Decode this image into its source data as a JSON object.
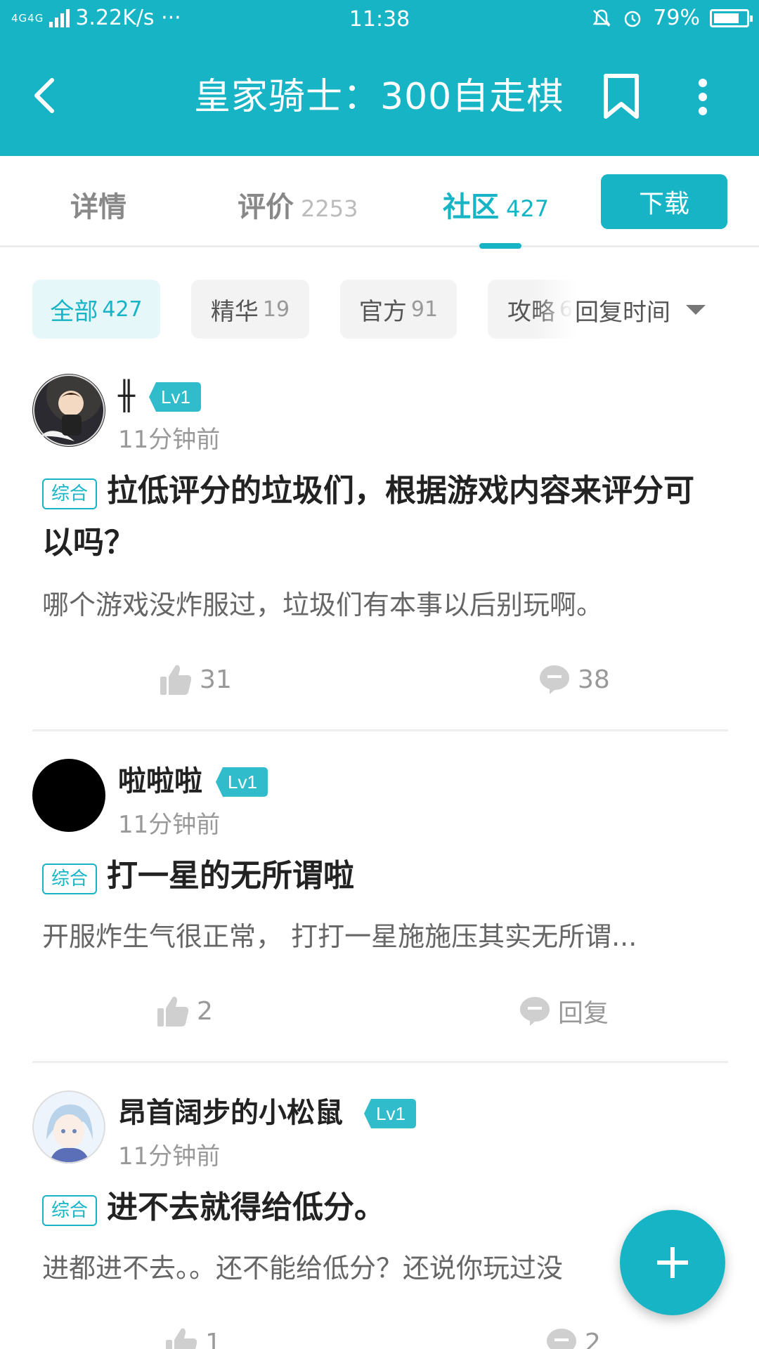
{
  "status_bar": {
    "network": "4G4G",
    "speed": "3.22K/s ···",
    "time": "11:38",
    "battery": "79%",
    "battery_fill": 0.79
  },
  "header": {
    "title": "皇家骑士：300自走棋"
  },
  "tabs": [
    {
      "label": "详情",
      "count": ""
    },
    {
      "label": "评价",
      "count": "2253"
    },
    {
      "label": "社区",
      "count": "427",
      "active": true
    }
  ],
  "download_label": "下载",
  "filters": [
    {
      "label": "全部",
      "count": "427",
      "active": true
    },
    {
      "label": "精华",
      "count": "19"
    },
    {
      "label": "官方",
      "count": "91"
    },
    {
      "label": "攻略",
      "count": "6"
    }
  ],
  "sort_label": "回复时间",
  "level_label": "Lv1",
  "tag_label": "综合",
  "posts": [
    {
      "username": "╫",
      "time": "11分钟前",
      "title": "拉低评分的垃圾们，根据游戏内容来评分可以吗？",
      "body": "哪个游戏没炸服过，垃圾们有本事以后别玩啊。",
      "likes": "31",
      "comments": "38"
    },
    {
      "username": "啦啦啦",
      "time": "11分钟前",
      "title": "打一星的无所谓啦",
      "body": "开服炸生气很正常， 打打一星施施压其实无所谓...",
      "likes": "2",
      "comments": "回复"
    },
    {
      "username": "昂首阔步的小松鼠",
      "time": "11分钟前",
      "title": "进不去就得给低分。",
      "body": "进都进不去。。还不能给低分？还说你玩过没",
      "likes": "1",
      "comments": "2"
    }
  ],
  "colors": {
    "accent": "#17b4c6",
    "accent_light": "#e6f7fa",
    "text_dark": "#222222",
    "text_muted": "#999999"
  },
  "icons": [
    "back-arrow-icon",
    "bookmark-icon",
    "more-vertical-icon",
    "thumbs-up-icon",
    "comment-icon",
    "plus-icon",
    "chevron-down-icon",
    "alarm-icon",
    "mute-bell-icon"
  ]
}
